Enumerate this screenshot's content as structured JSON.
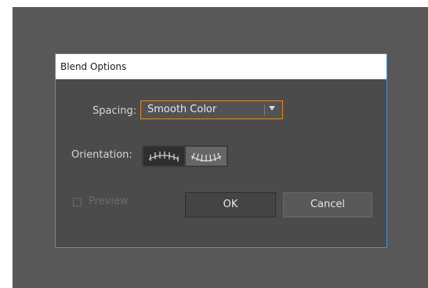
{
  "dialog": {
    "title": "Blend Options",
    "spacing_label": "Spacing:",
    "spacing_value": "Smooth Color",
    "orientation_label": "Orientation:",
    "orientation_options": [
      "align-to-page-icon",
      "align-to-path-icon"
    ],
    "orientation_selected": "align-to-page-icon",
    "preview_label": "Preview",
    "preview_checked": false,
    "ok_label": "OK",
    "cancel_label": "Cancel"
  },
  "colors": {
    "accent_focus": "#e58a26",
    "dialog_border": "#4a90d9",
    "dialog_bg": "#4b4b4b",
    "canvas_bg": "#585858"
  }
}
